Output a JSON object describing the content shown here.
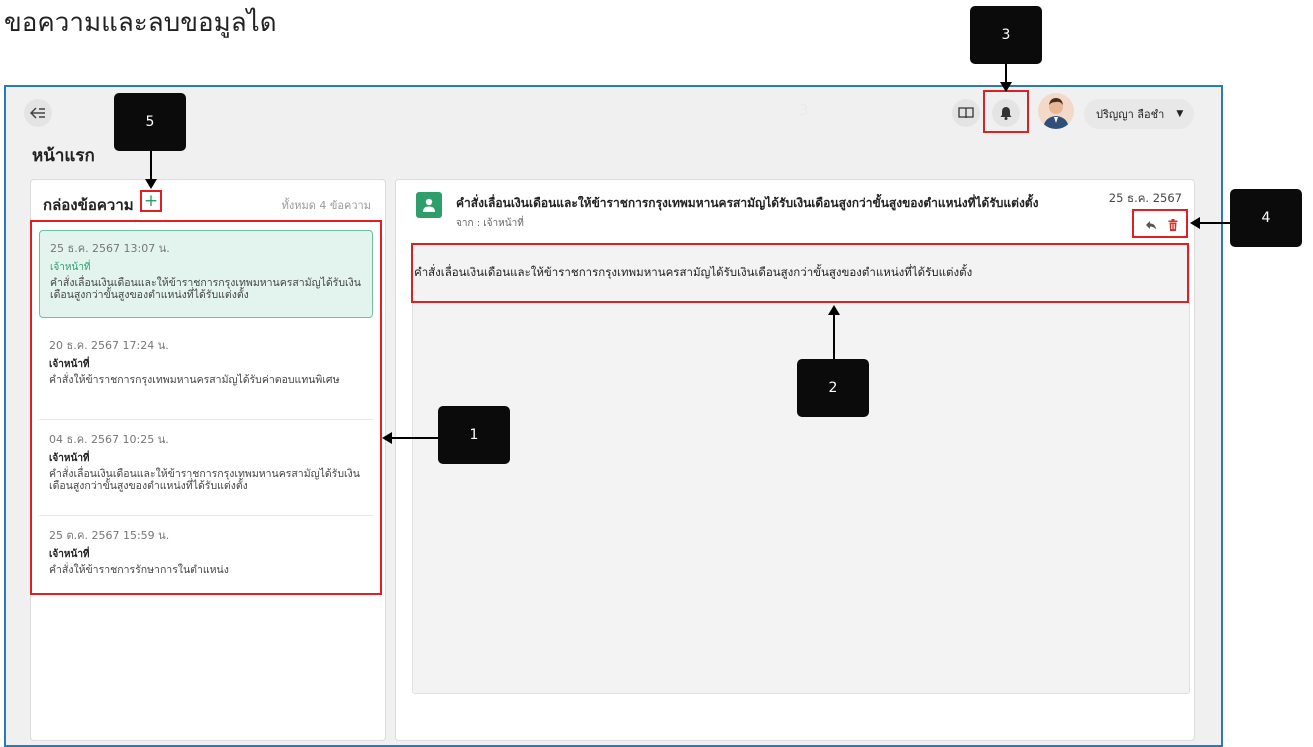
{
  "caption": "ขอความและลบขอมูลได",
  "header": {
    "page_title": "หน้าแรก",
    "faint_number": "3",
    "user_name": "ปริญญา ลือชำ",
    "caret": "▼"
  },
  "inbox": {
    "title": "กล่องข้อความ",
    "add_symbol": "+",
    "count_text": "ทั้งหมด 4 ข้อความ",
    "messages": [
      {
        "date": "25 ธ.ค. 2567 13:07 น.",
        "from": "เจ้าหน้าที่",
        "text": "คำสั่งเลื่อนเงินเดือนและให้ข้าราชการกรุงเทพมหานครสามัญได้รับเงินเดือนสูงกว่าขั้นสูงของตำแหน่งที่ได้รับแต่งตั้ง"
      },
      {
        "date": "20 ธ.ค. 2567 17:24 น.",
        "from": "เจ้าหน้าที่",
        "text": "คำสั่งให้ข้าราชการกรุงเทพมหานครสามัญได้รับค่าตอบแทนพิเศษ"
      },
      {
        "date": "04 ธ.ค. 2567 10:25 น.",
        "from": "เจ้าหน้าที่",
        "text": "คำสั่งเลื่อนเงินเดือนและให้ข้าราชการกรุงเทพมหานครสามัญได้รับเงินเดือนสูงกว่าขั้นสูงของตำแหน่งที่ได้รับแต่งตั้ง"
      },
      {
        "date": "25 ต.ค. 2567 15:59 น.",
        "from": "เจ้าหน้าที่",
        "text": "คำสั่งให้ข้าราชการรักษาการในตำแหน่ง"
      }
    ]
  },
  "detail": {
    "subject": "คำสั่งเลื่อนเงินเดือนและให้ข้าราชการกรุงเทพมหานครสามัญได้รับเงินเดือนสูงกว่าขั้นสูงของตำแหน่งที่ได้รับแต่งตั้ง",
    "from_line": "จาก : เจ้าหน้าที่",
    "date": "25 ธ.ค. 2567",
    "body": "คำสั่งเลื่อนเงินเดือนและให้ข้าราชการกรุงเทพมหานครสามัญได้รับเงินเดือนสูงกว่าขั้นสูงของตำแหน่งที่ได้รับแต่งตั้ง"
  },
  "callouts": [
    "1",
    "2",
    "3",
    "4",
    "5"
  ],
  "icons": [
    "collapse-icon",
    "book-icon",
    "bell-icon",
    "avatar",
    "add-icon",
    "person-icon",
    "reply-icon",
    "trash-icon"
  ],
  "colors": {
    "accent": "#2e9e6b",
    "highlight": "#e02020",
    "frame": "#2a7ab8"
  }
}
